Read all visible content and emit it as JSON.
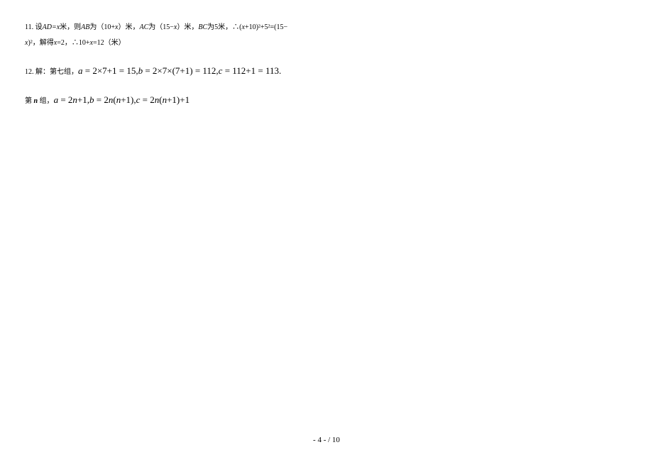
{
  "problem11": {
    "line1_prefix": "11. 设",
    "line1_ad": "AD=x",
    "line1_text1": "米，则",
    "line1_ab": "AB",
    "line1_text2": "为（10+",
    "line1_x1": "x",
    "line1_text3": "）米，",
    "line1_ac": "AC",
    "line1_text4": "为（15−",
    "line1_x2": "x",
    "line1_text5": "）米，",
    "line1_bc": "BC",
    "line1_text6": "为5米，∴(",
    "line1_x3": "x",
    "line1_text7": "+10)²+5²=(15−",
    "line2_x": "x",
    "line2_text1": ")²，解得",
    "line2_x2": "x",
    "line2_text2": "=2，∴10+",
    "line2_x3": "x",
    "line2_text3": "=12（米）"
  },
  "problem12": {
    "prefix": "12. 解：第七组，",
    "math_a": "a",
    "math_eq1": " = 2×7+1 = 15,",
    "math_b": "b",
    "math_eq2": " = 2×7×(7+1) = 112,",
    "math_c": "c",
    "math_eq3": " = 112+1 = 113."
  },
  "problemN": {
    "prefix": "第",
    "n": " n ",
    "text1": "组，",
    "math_a": "a",
    "math_eq1": " = 2",
    "math_n1": "n",
    "math_eq1b": "+1,",
    "math_b": "b",
    "math_eq2": " = 2",
    "math_n2": "n",
    "math_eq2b": "(",
    "math_n3": "n",
    "math_eq2c": "+1),",
    "math_c": "c",
    "math_eq3": " = 2",
    "math_n4": "n",
    "math_eq3b": "(",
    "math_n5": "n",
    "math_eq3c": "+1)+1"
  },
  "footer": "- 4 - / 10"
}
